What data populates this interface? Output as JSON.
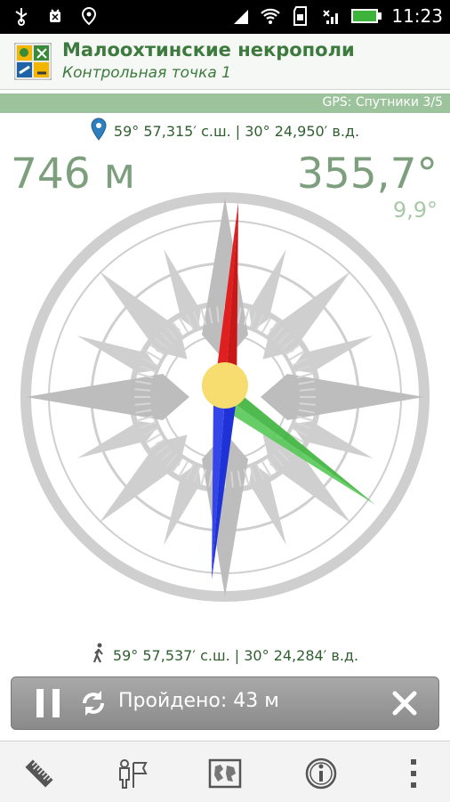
{
  "statusbar": {
    "time": "11:23",
    "icons": [
      "usb-icon",
      "android-debug-icon",
      "location-icon",
      "signal-icon",
      "wifi-icon",
      "sd-card-icon",
      "no-signal-icon",
      "battery-icon"
    ]
  },
  "actionbar": {
    "title": "Малоохтинские некрополи",
    "subtitle": "Контрольная точка 1"
  },
  "gps": {
    "status": "GPS: Спутники 3/5"
  },
  "target_coords": "59° 57,315′ с.ш. | 30° 24,950′ в.д.",
  "distance": "746 м",
  "bearing": "355,7°",
  "accuracy": "9,9°",
  "current_coords": "59° 57,537′ с.ш. | 30° 24,284′ в.д.",
  "travel": {
    "label": "Пройдено: 43 м"
  },
  "bottombar": {
    "buttons": [
      "ruler-icon",
      "waypoint-icon",
      "map-icon",
      "info-icon",
      "overflow-icon"
    ]
  },
  "colors": {
    "accent": "#3d7a3d",
    "needle_north": "#e02020",
    "needle_south": "#2020e0",
    "needle_target": "#3cb43c",
    "needle_center": "#f7dc6f"
  }
}
